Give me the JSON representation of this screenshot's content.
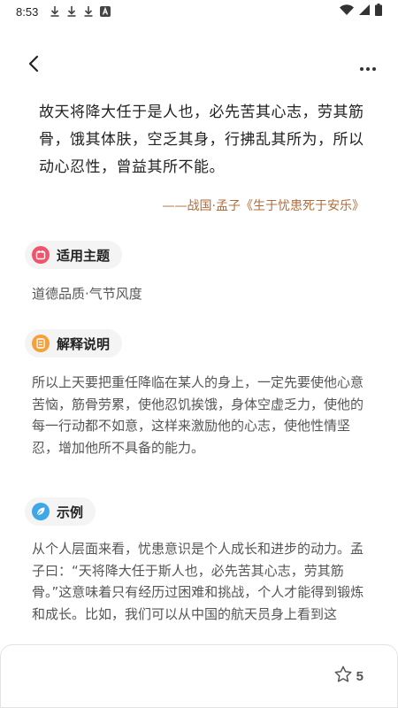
{
  "status_bar": {
    "time": "8:53"
  },
  "quote": {
    "text": "故天将降大任于是人也，必先苦其心志，劳其筋骨，饿其体肤，空乏其身，行拂乱其所为，所以动心忍性，曾益其所不能。",
    "source": "——战国·孟子《生于忧患死于安乐》"
  },
  "sections": {
    "theme": {
      "label": "适用主题",
      "text": "道德品质·气节风度"
    },
    "explanation": {
      "label": "解释说明",
      "text": "所以上天要把重任降临在某人的身上，一定先要使他心意苦恼，筋骨劳累，使他忍饥挨饿，身体空虚乏力，使他的每一行动都不如意，这样来激励他的心志，使他性情坚忍，增加他所不具备的能力。"
    },
    "example": {
      "label": "示例",
      "text": "从个人层面来看，忧患意识是个人成长和进步的动力。孟子曰：“天将降大任于斯人也，必先苦其心志，劳其筋骨。”这意味着只有经历过困难和挑战，个人才能得到锻炼和成长。比如，我们可以从中国的航天员身上看到这"
    }
  },
  "bottom_bar": {
    "star_count": "5"
  },
  "colors": {
    "accent_source": "#b06c3a",
    "theme_icon": "#f0546c",
    "explanation_icon": "#f5a03a",
    "example_icon": "#3fa7e8"
  },
  "icons": {
    "back": "back-icon",
    "more": "more-icon",
    "theme": "calendar-icon",
    "explanation": "document-icon",
    "example": "leaf-icon",
    "star": "star-icon"
  }
}
